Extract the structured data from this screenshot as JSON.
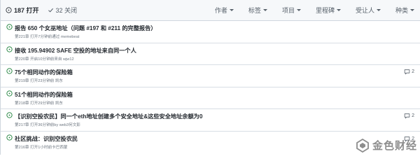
{
  "header": {
    "open_label": "187 打开",
    "closed_label": "32 关闭",
    "filters": [
      "作者",
      "标签",
      "项目",
      "里程碑",
      "受让人",
      "种类"
    ]
  },
  "issues": [
    {
      "title": "报告 650 个女巫地址（问题 #197 和 #211 的完整报告）",
      "meta": "第221章 打开7分钟前通过 memebeat",
      "comments": ""
    },
    {
      "title": "接收 195.94902 SAFE 空投的地址来自同一个人",
      "meta": "第220章 开启10分钟前来自 wjw12",
      "comments": ""
    },
    {
      "title": "75个相同动作的保险箱",
      "meta": "第219章 打开23分钟前 凯东",
      "comments": "2"
    },
    {
      "title": "51个相同动作的保险箱",
      "meta": "第218章 打开29分钟前 凯东",
      "comments": ""
    },
    {
      "title": "【识别空投农民】同一个eth地址创建多个安全地址&这些安全地址余额为0",
      "meta": "第217章 打开36分钟前by web3何文彭",
      "comments": "2"
    },
    {
      "title": "社区挑战：识别空投农民",
      "meta": "第216章 打开1小时前卡巴西蒙",
      "comments": "2"
    }
  ],
  "watermark": {
    "text": "金色财经"
  },
  "colors": {
    "open_green": "#1a7f37",
    "header_bg": "#f6f8fa",
    "border": "#d0d7de",
    "muted": "#57606a"
  }
}
